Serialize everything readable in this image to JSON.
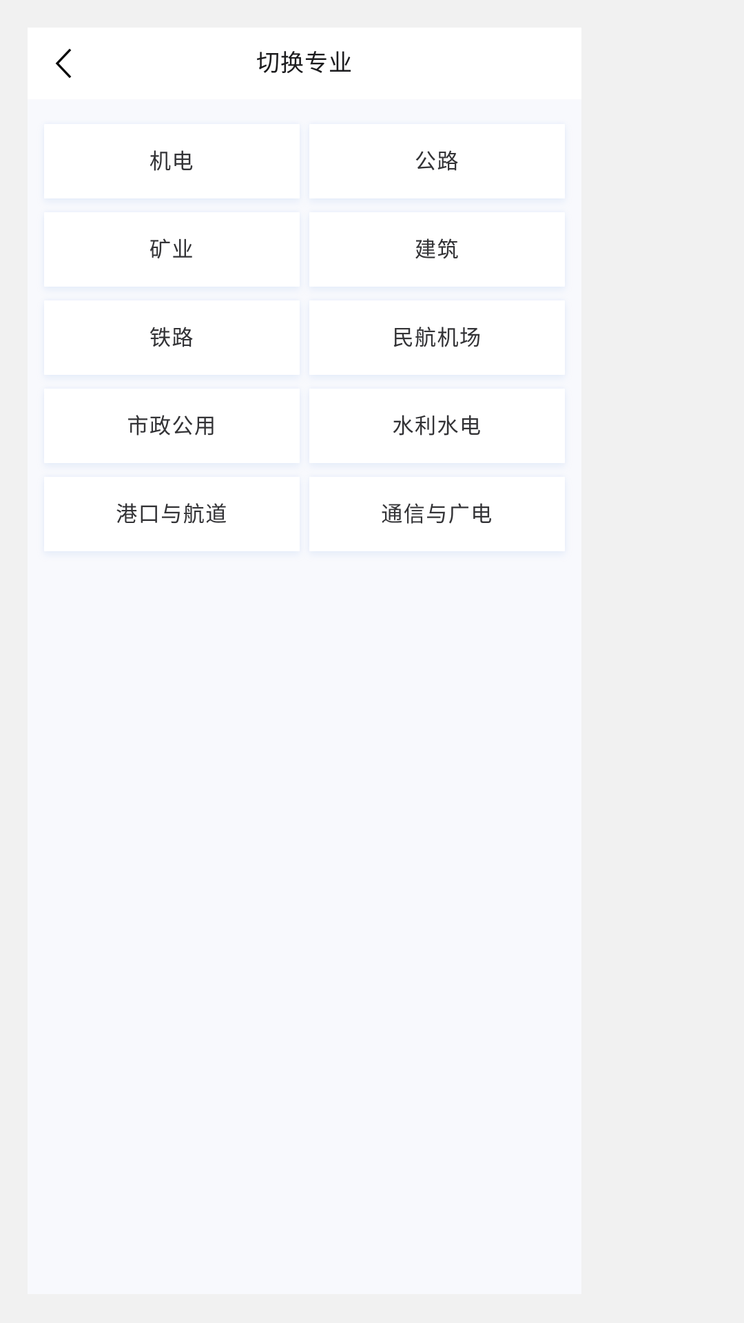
{
  "screen": {
    "background_color": "#f1f1f1",
    "page_background_color": "#f8f9fd"
  },
  "nav_bar": {
    "title": "切换专业",
    "back_icon": "chevron-left-icon",
    "background_color": "#ffffff"
  },
  "major_grid": {
    "columns": 2,
    "card_background_color": "#ffffff",
    "label_color": "#333336",
    "items": [
      {
        "label": "机电"
      },
      {
        "label": "公路"
      },
      {
        "label": "矿业"
      },
      {
        "label": "建筑"
      },
      {
        "label": "铁路"
      },
      {
        "label": "民航机场"
      },
      {
        "label": "市政公用"
      },
      {
        "label": "水利水电"
      },
      {
        "label": "港口与航道"
      },
      {
        "label": "通信与广电"
      }
    ]
  }
}
